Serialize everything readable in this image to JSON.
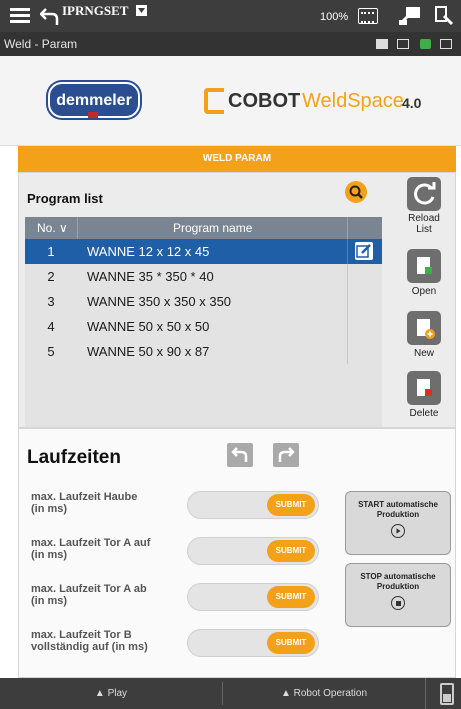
{
  "topbar": {
    "title": "IPRNGSET",
    "zoom": "100%"
  },
  "subbar": {
    "breadcrumb": "Weld - Param"
  },
  "logos": {
    "demmeler": "demmeler",
    "cobot_bold": "COBOT",
    "cobot_light": "WeldSpace",
    "cobot_version": "4.0"
  },
  "weld_param": {
    "heading": "WELD PARAM"
  },
  "program_list": {
    "title": "Program list",
    "col_no": "No. ∨",
    "col_name": "Program name",
    "rows": [
      {
        "no": "1",
        "name": "WANNE 12 x 12 x 45"
      },
      {
        "no": "2",
        "name": "WANNE 35 * 350 * 40"
      },
      {
        "no": "3",
        "name": "WANNE 350 x 350 x 350"
      },
      {
        "no": "4",
        "name": "WANNE 50 x 50 x 50"
      },
      {
        "no": "5",
        "name": "WANNE 50 x 90 x 87"
      }
    ],
    "selected_row": 1
  },
  "side_buttons": {
    "reload": "Reload List",
    "open": "Open",
    "new": "New",
    "delete": "Delete"
  },
  "laufzeiten": {
    "title": "Laufzeiten",
    "fields": [
      {
        "label": "max. Laufzeit Haube (in ms)",
        "submit": "SUBMIT"
      },
      {
        "label": "max. Laufzeit Tor A auf (in ms)",
        "submit": "SUBMIT"
      },
      {
        "label": "max. Laufzeit Tor A ab (in ms)",
        "submit": "SUBMIT"
      },
      {
        "label": "max. Laufzeit Tor B vollständig auf (in ms)",
        "submit": "SUBMIT"
      }
    ],
    "start_btn": "START automatische Produktion",
    "stop_btn": "STOP automatische Produktion"
  },
  "bottombar": {
    "play": "▲ Play",
    "robot_operation": "▲ Robot Operation"
  },
  "colors": {
    "accent_orange": "#f4a11a",
    "selected_blue": "#1f5fa8",
    "bar_dark": "#3d3d3d"
  }
}
